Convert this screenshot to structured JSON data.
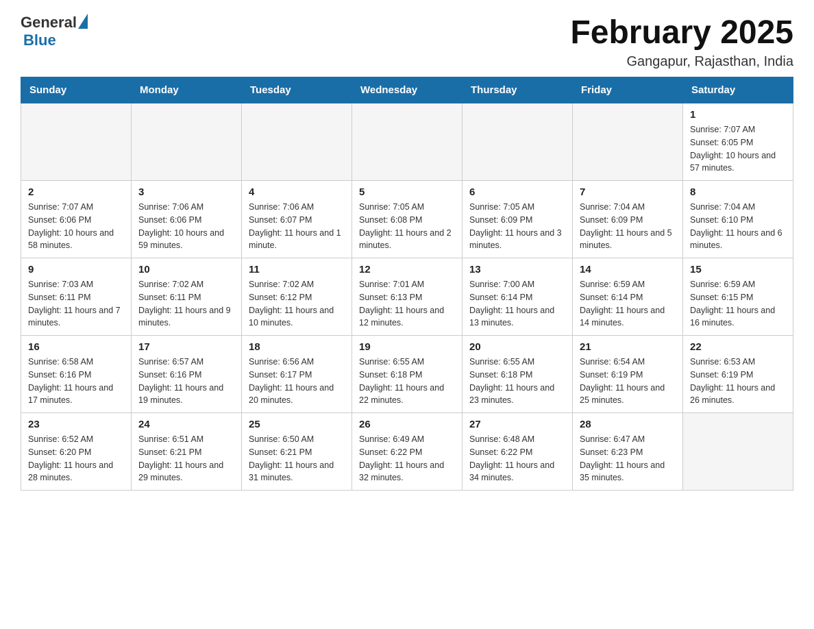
{
  "logo": {
    "general": "General",
    "blue": "Blue"
  },
  "title": {
    "month_year": "February 2025",
    "location": "Gangapur, Rajasthan, India"
  },
  "days_of_week": [
    "Sunday",
    "Monday",
    "Tuesday",
    "Wednesday",
    "Thursday",
    "Friday",
    "Saturday"
  ],
  "weeks": [
    [
      {
        "day": "",
        "info": ""
      },
      {
        "day": "",
        "info": ""
      },
      {
        "day": "",
        "info": ""
      },
      {
        "day": "",
        "info": ""
      },
      {
        "day": "",
        "info": ""
      },
      {
        "day": "",
        "info": ""
      },
      {
        "day": "1",
        "info": "Sunrise: 7:07 AM\nSunset: 6:05 PM\nDaylight: 10 hours and 57 minutes."
      }
    ],
    [
      {
        "day": "2",
        "info": "Sunrise: 7:07 AM\nSunset: 6:06 PM\nDaylight: 10 hours and 58 minutes."
      },
      {
        "day": "3",
        "info": "Sunrise: 7:06 AM\nSunset: 6:06 PM\nDaylight: 10 hours and 59 minutes."
      },
      {
        "day": "4",
        "info": "Sunrise: 7:06 AM\nSunset: 6:07 PM\nDaylight: 11 hours and 1 minute."
      },
      {
        "day": "5",
        "info": "Sunrise: 7:05 AM\nSunset: 6:08 PM\nDaylight: 11 hours and 2 minutes."
      },
      {
        "day": "6",
        "info": "Sunrise: 7:05 AM\nSunset: 6:09 PM\nDaylight: 11 hours and 3 minutes."
      },
      {
        "day": "7",
        "info": "Sunrise: 7:04 AM\nSunset: 6:09 PM\nDaylight: 11 hours and 5 minutes."
      },
      {
        "day": "8",
        "info": "Sunrise: 7:04 AM\nSunset: 6:10 PM\nDaylight: 11 hours and 6 minutes."
      }
    ],
    [
      {
        "day": "9",
        "info": "Sunrise: 7:03 AM\nSunset: 6:11 PM\nDaylight: 11 hours and 7 minutes."
      },
      {
        "day": "10",
        "info": "Sunrise: 7:02 AM\nSunset: 6:11 PM\nDaylight: 11 hours and 9 minutes."
      },
      {
        "day": "11",
        "info": "Sunrise: 7:02 AM\nSunset: 6:12 PM\nDaylight: 11 hours and 10 minutes."
      },
      {
        "day": "12",
        "info": "Sunrise: 7:01 AM\nSunset: 6:13 PM\nDaylight: 11 hours and 12 minutes."
      },
      {
        "day": "13",
        "info": "Sunrise: 7:00 AM\nSunset: 6:14 PM\nDaylight: 11 hours and 13 minutes."
      },
      {
        "day": "14",
        "info": "Sunrise: 6:59 AM\nSunset: 6:14 PM\nDaylight: 11 hours and 14 minutes."
      },
      {
        "day": "15",
        "info": "Sunrise: 6:59 AM\nSunset: 6:15 PM\nDaylight: 11 hours and 16 minutes."
      }
    ],
    [
      {
        "day": "16",
        "info": "Sunrise: 6:58 AM\nSunset: 6:16 PM\nDaylight: 11 hours and 17 minutes."
      },
      {
        "day": "17",
        "info": "Sunrise: 6:57 AM\nSunset: 6:16 PM\nDaylight: 11 hours and 19 minutes."
      },
      {
        "day": "18",
        "info": "Sunrise: 6:56 AM\nSunset: 6:17 PM\nDaylight: 11 hours and 20 minutes."
      },
      {
        "day": "19",
        "info": "Sunrise: 6:55 AM\nSunset: 6:18 PM\nDaylight: 11 hours and 22 minutes."
      },
      {
        "day": "20",
        "info": "Sunrise: 6:55 AM\nSunset: 6:18 PM\nDaylight: 11 hours and 23 minutes."
      },
      {
        "day": "21",
        "info": "Sunrise: 6:54 AM\nSunset: 6:19 PM\nDaylight: 11 hours and 25 minutes."
      },
      {
        "day": "22",
        "info": "Sunrise: 6:53 AM\nSunset: 6:19 PM\nDaylight: 11 hours and 26 minutes."
      }
    ],
    [
      {
        "day": "23",
        "info": "Sunrise: 6:52 AM\nSunset: 6:20 PM\nDaylight: 11 hours and 28 minutes."
      },
      {
        "day": "24",
        "info": "Sunrise: 6:51 AM\nSunset: 6:21 PM\nDaylight: 11 hours and 29 minutes."
      },
      {
        "day": "25",
        "info": "Sunrise: 6:50 AM\nSunset: 6:21 PM\nDaylight: 11 hours and 31 minutes."
      },
      {
        "day": "26",
        "info": "Sunrise: 6:49 AM\nSunset: 6:22 PM\nDaylight: 11 hours and 32 minutes."
      },
      {
        "day": "27",
        "info": "Sunrise: 6:48 AM\nSunset: 6:22 PM\nDaylight: 11 hours and 34 minutes."
      },
      {
        "day": "28",
        "info": "Sunrise: 6:47 AM\nSunset: 6:23 PM\nDaylight: 11 hours and 35 minutes."
      },
      {
        "day": "",
        "info": ""
      }
    ]
  ]
}
